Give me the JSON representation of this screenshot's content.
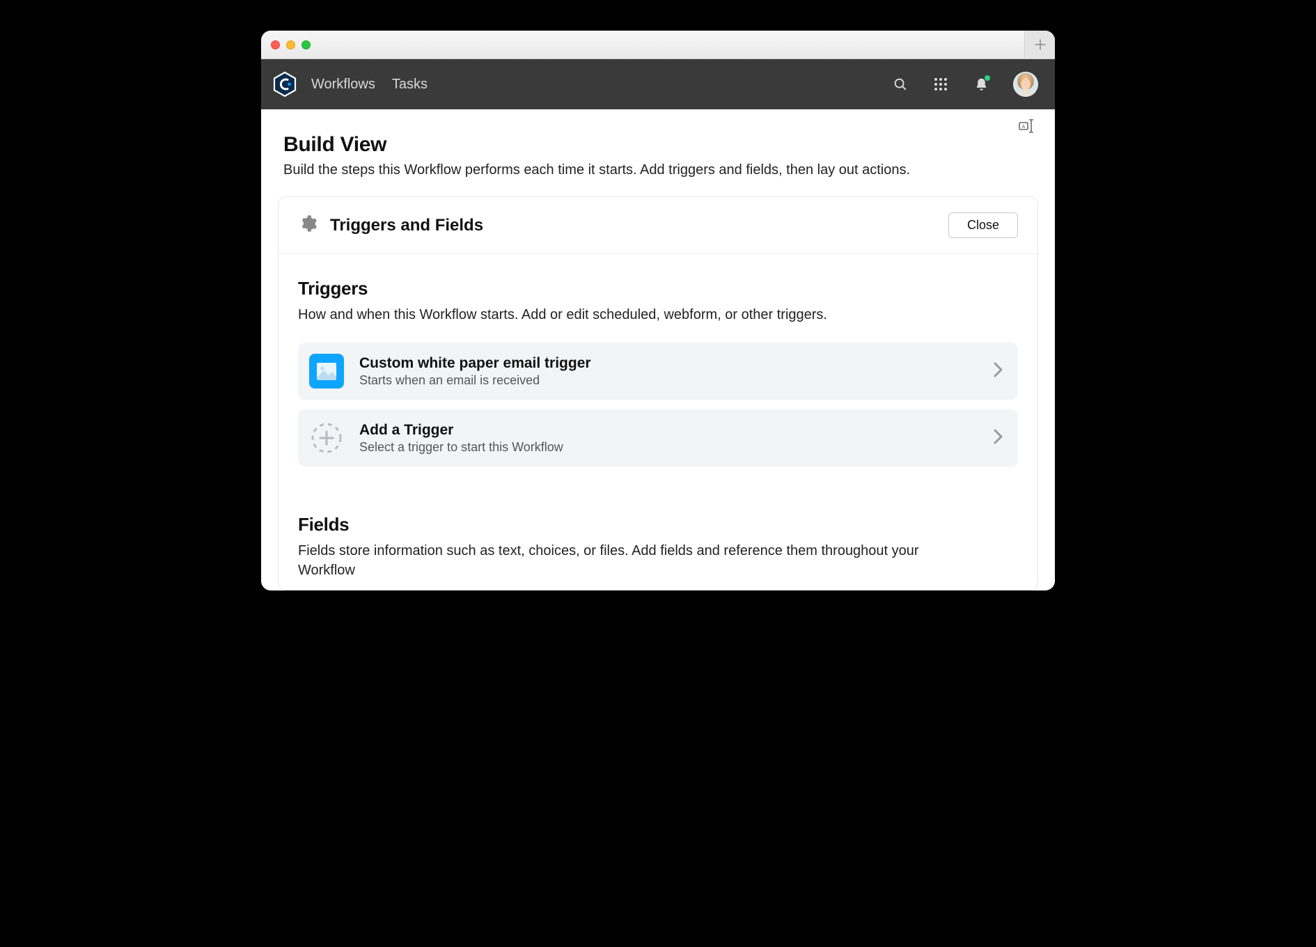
{
  "nav": {
    "items": [
      "Workflows",
      "Tasks"
    ]
  },
  "page": {
    "title": "Build View",
    "subtitle": "Build the steps this Workflow performs each time it starts. Add triggers and fields, then lay out actions."
  },
  "panel": {
    "title": "Triggers and Fields",
    "close_label": "Close"
  },
  "triggers": {
    "heading": "Triggers",
    "subheading": "How and when this Workflow starts. Add or edit scheduled, webform, or other triggers.",
    "items": [
      {
        "icon": "email",
        "title": "Custom white paper email trigger",
        "subtitle": "Starts when an email is received"
      },
      {
        "icon": "add",
        "title": "Add a Trigger",
        "subtitle": "Select a trigger to start this Workflow"
      }
    ]
  },
  "fields": {
    "heading": "Fields",
    "subheading": "Fields store information such as text, choices, or files. Add fields and reference them throughout your Workflow"
  }
}
